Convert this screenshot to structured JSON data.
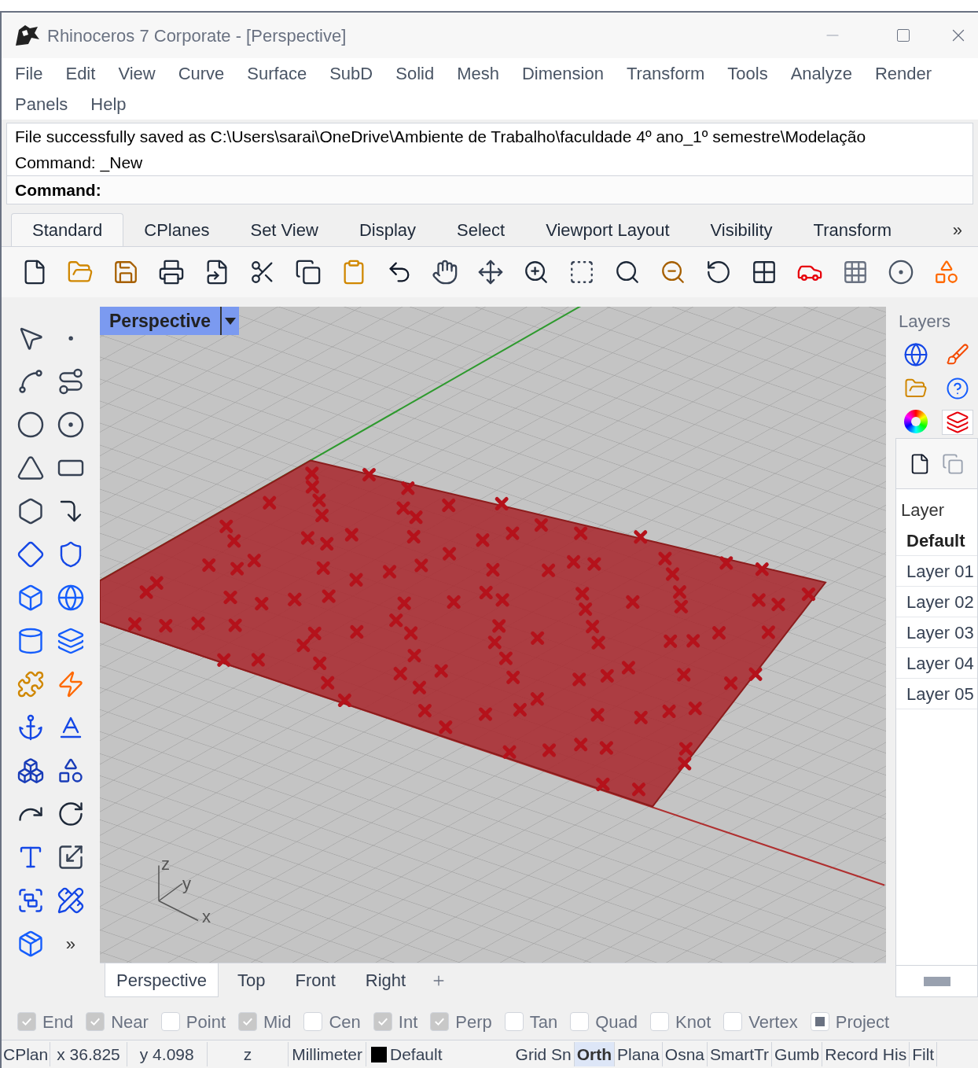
{
  "window": {
    "title": "Rhinoceros 7 Corporate - [Perspective]"
  },
  "menu_rows": [
    [
      "File",
      "Edit",
      "View",
      "Curve",
      "Surface",
      "SubD",
      "Solid",
      "Mesh",
      "Dimension",
      "Transform",
      "Tools",
      "Analyze",
      "Render"
    ],
    [
      "Panels",
      "Help"
    ]
  ],
  "command": {
    "history": [
      "File successfully saved as C:\\Users\\sarai\\OneDrive\\Ambiente de Trabalho\\faculdade 4º ano_1º semestre\\Modelação",
      "Command: _New"
    ],
    "prompt": "Command:"
  },
  "toolbar_tabs": [
    {
      "label": "Standard",
      "selected": true
    },
    {
      "label": "CPlanes",
      "selected": false
    },
    {
      "label": "Set View",
      "selected": false
    },
    {
      "label": "Display",
      "selected": false
    },
    {
      "label": "Select",
      "selected": false
    },
    {
      "label": "Viewport Layout",
      "selected": false
    },
    {
      "label": "Visibility",
      "selected": false
    },
    {
      "label": "Transform",
      "selected": false
    }
  ],
  "toolbar_more": "»",
  "toolbox_more": "»",
  "viewport": {
    "label": "Perspective",
    "axis_labels": [
      "z",
      "y",
      "x"
    ]
  },
  "layers_panel": {
    "title": "Layers",
    "column": "Layer",
    "layers": [
      {
        "name": "Default",
        "current": true
      },
      {
        "name": "Layer 01",
        "current": false
      },
      {
        "name": "Layer 02",
        "current": false
      },
      {
        "name": "Layer 03",
        "current": false
      },
      {
        "name": "Layer 04",
        "current": false
      },
      {
        "name": "Layer 05",
        "current": false
      }
    ]
  },
  "viewport_tabs": [
    {
      "label": "Perspective",
      "selected": true
    },
    {
      "label": "Top",
      "selected": false
    },
    {
      "label": "Front",
      "selected": false
    },
    {
      "label": "Right",
      "selected": false
    }
  ],
  "osnaps": [
    {
      "label": "End",
      "kind": "check",
      "checked": true
    },
    {
      "label": "Near",
      "kind": "check",
      "checked": true
    },
    {
      "label": "Point",
      "kind": "check",
      "checked": false
    },
    {
      "label": "Mid",
      "kind": "check",
      "checked": true
    },
    {
      "label": "Cen",
      "kind": "check",
      "checked": false
    },
    {
      "label": "Int",
      "kind": "check",
      "checked": true
    },
    {
      "label": "Perp",
      "kind": "check",
      "checked": true
    },
    {
      "label": "Tan",
      "kind": "check",
      "checked": false
    },
    {
      "label": "Quad",
      "kind": "check",
      "checked": false
    },
    {
      "label": "Knot",
      "kind": "check",
      "checked": false
    },
    {
      "label": "Vertex",
      "kind": "check",
      "checked": false
    },
    {
      "label": "Project",
      "kind": "toggle",
      "checked": true
    }
  ],
  "status_bar": {
    "cplane": "CPlan",
    "x": "x 36.825",
    "y": "y 4.098",
    "z": "z",
    "units": "Millimeter",
    "layer": {
      "name": "Default",
      "color": "#000000"
    },
    "toggles": [
      {
        "label": "Grid Sn",
        "on": false
      },
      {
        "label": "Orth",
        "on": true
      },
      {
        "label": "Plana",
        "on": false
      },
      {
        "label": "Osna",
        "on": false
      },
      {
        "label": "SmartTr",
        "on": false
      },
      {
        "label": "Gumb",
        "on": false
      },
      {
        "label": "Record His",
        "on": false
      },
      {
        "label": "Filt",
        "on": false
      }
    ]
  }
}
